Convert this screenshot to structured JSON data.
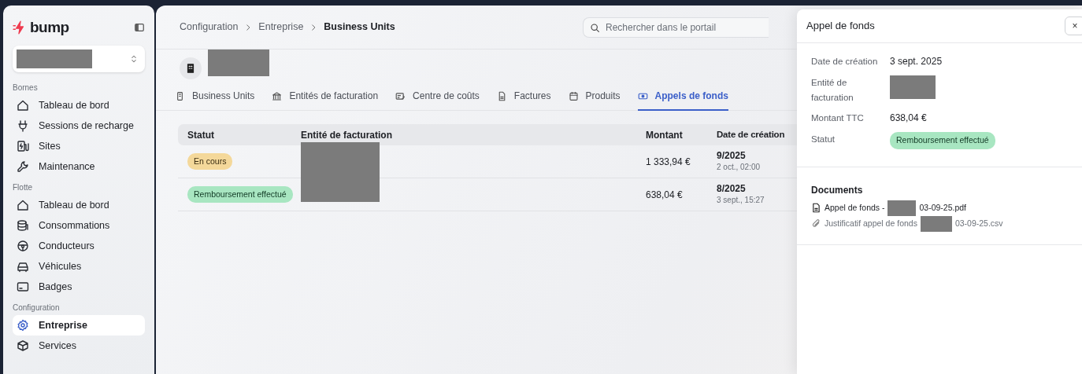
{
  "sidebar": {
    "logo": "bump",
    "sections": [
      {
        "title": "Bornes",
        "items": [
          {
            "label": "Tableau de bord",
            "selected": false
          },
          {
            "label": "Sessions de recharge",
            "selected": false
          },
          {
            "label": "Sites",
            "selected": false
          },
          {
            "label": "Maintenance",
            "selected": false
          }
        ]
      },
      {
        "title": "Flotte",
        "items": [
          {
            "label": "Tableau de bord",
            "selected": false
          },
          {
            "label": "Consommations",
            "selected": false
          },
          {
            "label": "Conducteurs",
            "selected": false
          },
          {
            "label": "Véhicules",
            "selected": false
          },
          {
            "label": "Badges",
            "selected": false
          }
        ]
      },
      {
        "title": "Configuration",
        "items": [
          {
            "label": "Entreprise",
            "selected": true
          },
          {
            "label": "Services",
            "selected": false
          }
        ]
      }
    ]
  },
  "breadcrumb": [
    "Configuration",
    "Entreprise",
    "Business Units"
  ],
  "search": {
    "placeholder": "Rechercher dans le portail"
  },
  "tabs": [
    {
      "label": "Business Units",
      "selected": false
    },
    {
      "label": "Entités de facturation",
      "selected": false
    },
    {
      "label": "Centre de coûts",
      "selected": false
    },
    {
      "label": "Factures",
      "selected": false
    },
    {
      "label": "Produits",
      "selected": false
    },
    {
      "label": "Appels de fonds",
      "selected": true
    }
  ],
  "table": {
    "columns": [
      "Statut",
      "Entité de facturation",
      "Montant",
      "Date de création"
    ],
    "rows": [
      {
        "status": {
          "label": "En cours",
          "kind": "pending"
        },
        "amount": "1 333,94 €",
        "period": "9/2025",
        "date": "2 oct., 02:00"
      },
      {
        "status": {
          "label": "Remboursement effectué",
          "kind": "refunded"
        },
        "amount": "638,04 €",
        "period": "8/2025",
        "date": "3 sept., 15:27"
      }
    ]
  },
  "drawer": {
    "title": "Appel de fonds",
    "close": "×",
    "fields": [
      {
        "label": "Date de création",
        "value": "3 sept. 2025",
        "kind": "text"
      },
      {
        "label": "Entité de facturation",
        "kind": "redacted"
      },
      {
        "label": "Montant TTC",
        "value": "638,04 €",
        "kind": "text"
      },
      {
        "label": "Statut",
        "kind": "badge",
        "status": {
          "label": "Remboursement effectué",
          "kind": "refunded"
        }
      }
    ],
    "documents_title": "Documents",
    "documents": [
      {
        "kind": "pdf",
        "before": "Appel de fonds -",
        "after": "03-09-25.pdf"
      },
      {
        "kind": "attachment",
        "before": "Justificatif appel de fonds",
        "after": "03-09-25.csv"
      }
    ]
  }
}
